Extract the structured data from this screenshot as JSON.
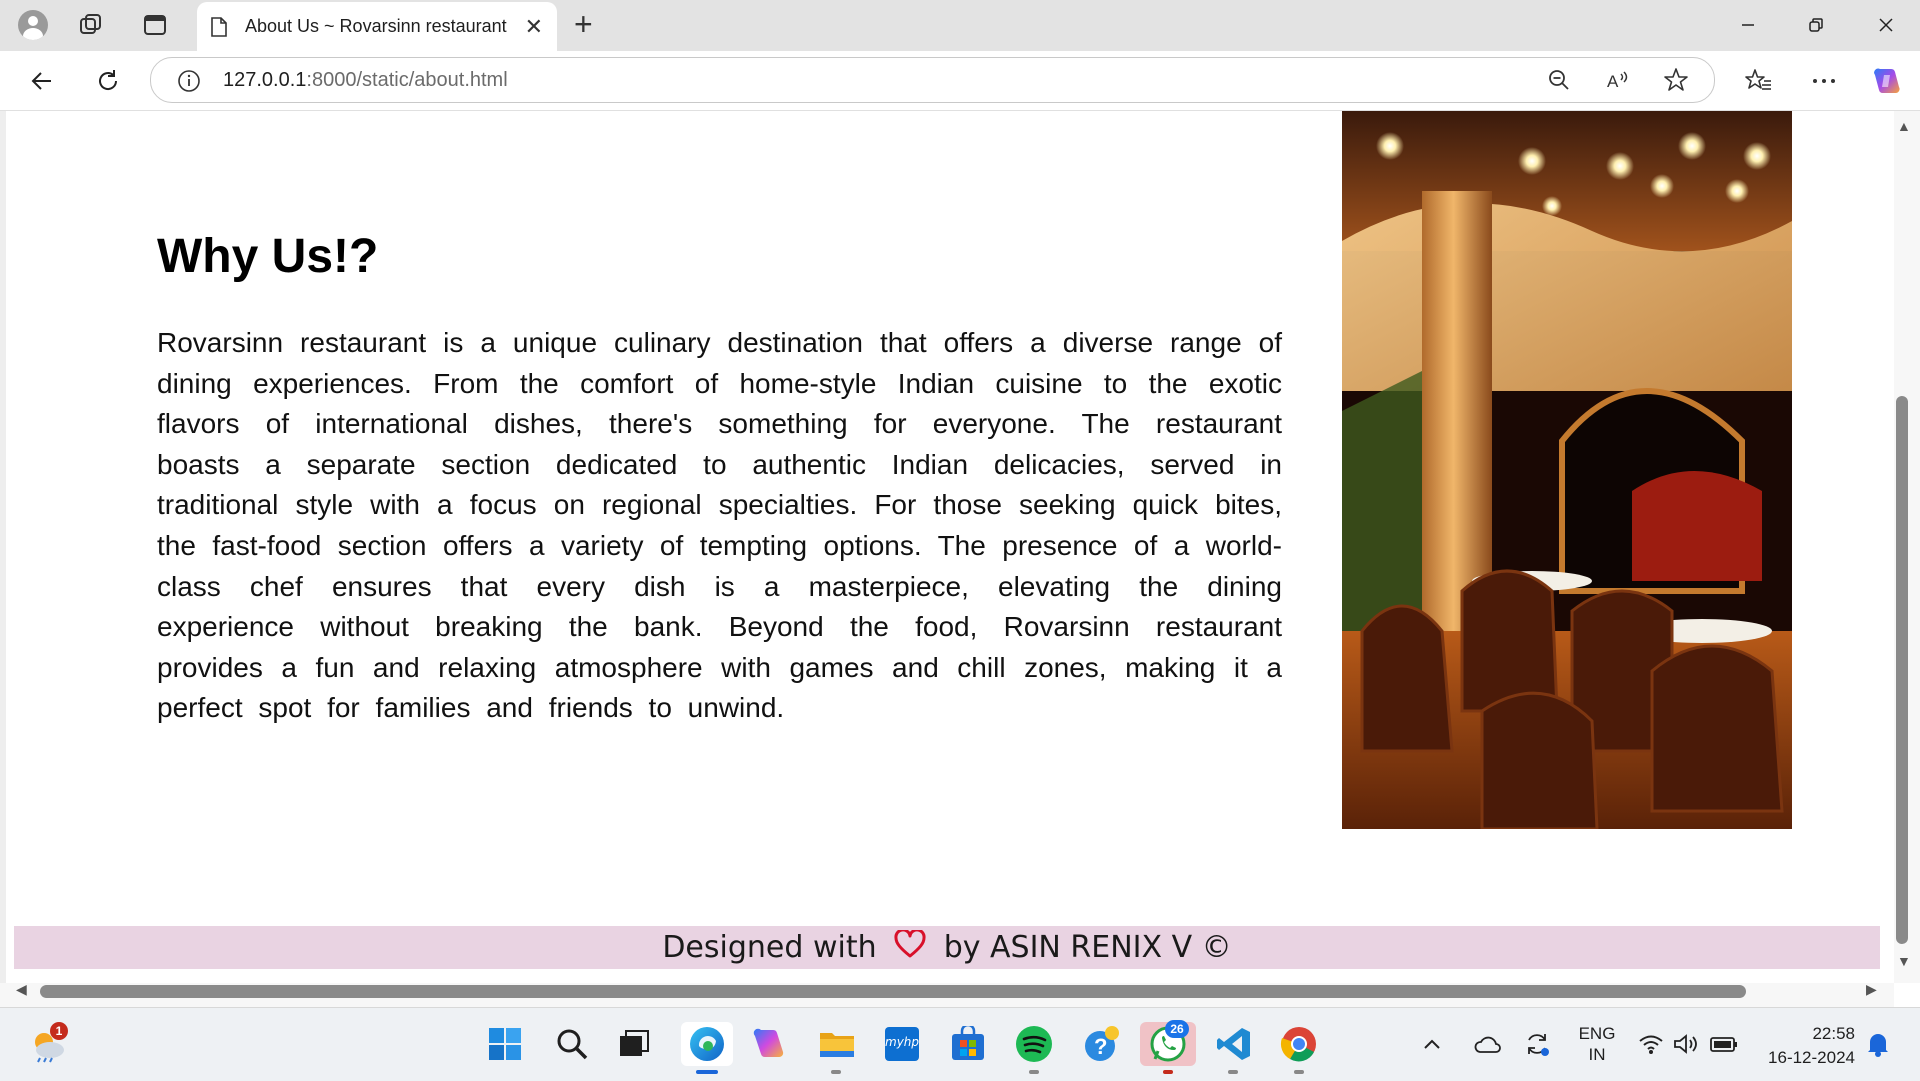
{
  "browser": {
    "tab_title": "About Us ~ Rovarsinn restaurant",
    "url_host": "127.0.0.1",
    "url_path": ":8000/static/about.html",
    "icons": [
      "profile-icon",
      "workspaces-icon",
      "tab-actions-icon",
      "page-icon",
      "close-tab-icon",
      "new-tab-icon",
      "minimize-icon",
      "restore-icon",
      "close-window-icon",
      "back-icon",
      "refresh-icon",
      "site-info-icon",
      "zoom-out-icon",
      "read-aloud-icon",
      "favorite-star-icon",
      "favorites-icon",
      "more-menu-icon",
      "copilot-icon"
    ]
  },
  "page": {
    "heading": "Why Us!?",
    "paragraph": "Rovarsinn restaurant is a unique culinary destination that offers a diverse range of dining experiences. From the comfort of home-style Indian cuisine to the exotic flavors of international dishes, there's something for everyone. The restaurant boasts a separate section dedicated to authentic Indian delicacies, served in traditional style with a focus on regional specialties. For those seeking quick bites, the fast-food section offers a variety of tempting options. The presence of a world-class chef ensures that every dish is a masterpiece, elevating the dining experience without breaking the bank. Beyond the food, Rovarsinn restaurant provides a fun and relaxing atmosphere with games and chill zones, making it a perfect spot for families and friends to unwind.",
    "footer_prefix": "Designed with",
    "footer_suffix": "by ASIN RENIX V ©",
    "footer_heart_color": "#d8102a",
    "footer_bg": "#e9d3e2"
  },
  "taskbar": {
    "weather_badge": "1",
    "whatsapp_badge": "26",
    "language_line1": "ENG",
    "language_line2": "IN",
    "time": "22:58",
    "date": "16-12-2024",
    "myhp_label": "myhp"
  }
}
